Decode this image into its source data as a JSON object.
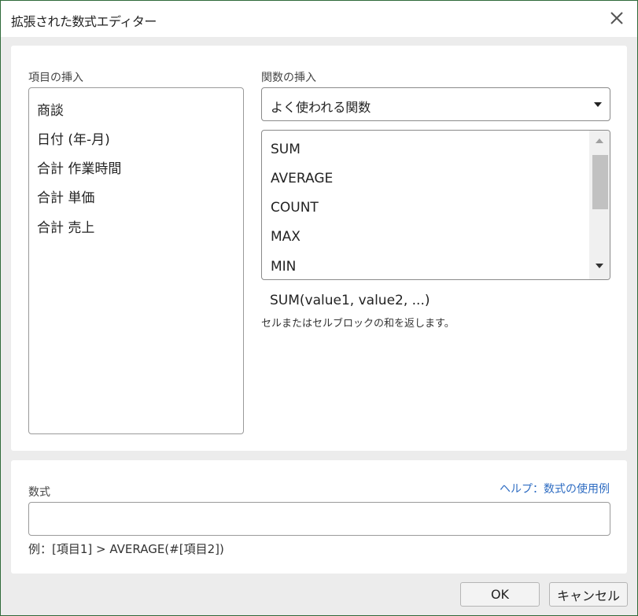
{
  "dialog": {
    "title": "拡張された数式エディター",
    "close_icon": "close-icon"
  },
  "items_section": {
    "label": "項目の挿入",
    "items": [
      "商談",
      "日付 (年-月)",
      "合計 作業時間",
      "合計 単価",
      "合計 売上"
    ]
  },
  "functions_section": {
    "label": "関数の挿入",
    "category_selected": "よく使われる関数",
    "functions": [
      "SUM",
      "AVERAGE",
      "COUNT",
      "MAX",
      "MIN"
    ],
    "selected_signature": "SUM(value1, value2, ...)",
    "selected_description": "セルまたはセルブロックの和を返します。"
  },
  "formula_section": {
    "label": "数式",
    "help_link": "ヘルプ：数式の使用例",
    "value": "",
    "example": "例：[項目1] > AVERAGE(#[項目2])"
  },
  "buttons": {
    "ok": "OK",
    "cancel": "キャンセル"
  }
}
